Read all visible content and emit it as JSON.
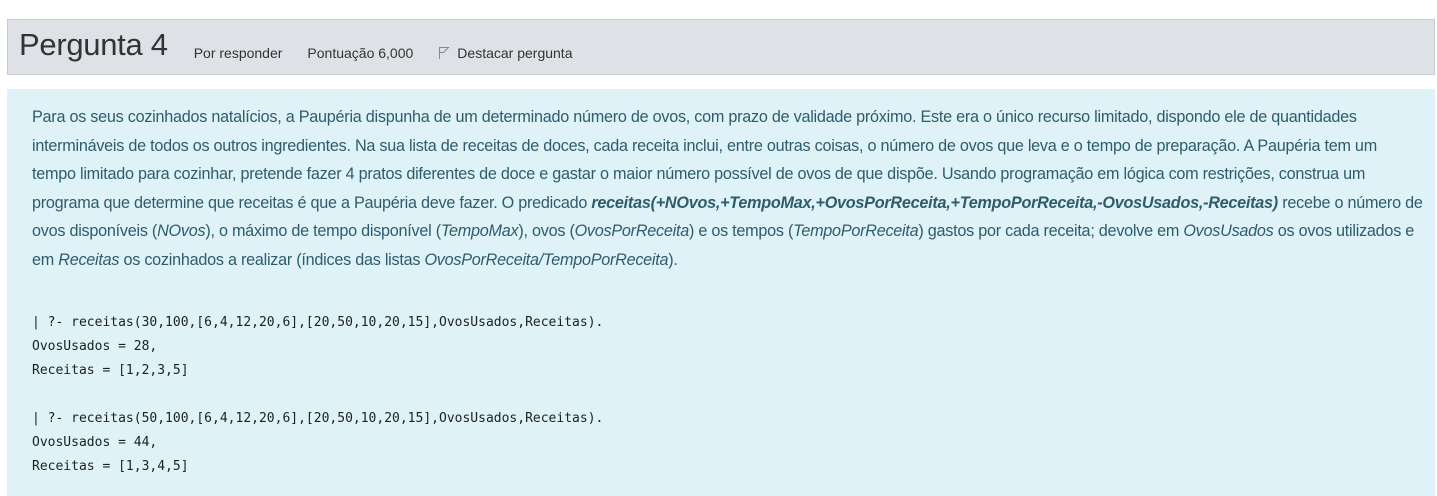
{
  "header": {
    "title_prefix": "Pergunta",
    "number": "4",
    "status": "Por responder",
    "score": "Pontuação 6,000",
    "flag_label": "Destacar pergunta"
  },
  "question": {
    "p1": "Para os seus cozinhados natalícios, a Paupéria dispunha de um determinado número de ovos, com prazo de validade próximo. Este era o único recurso limitado, dispondo ele de quantidades intermináveis de todos os outros ingredientes. Na sua lista de receitas de doces, cada receita inclui, entre outras coisas, o número de ovos que leva e o tempo de preparação. A Paupéria tem um tempo limitado para cozinhar, pretende fazer 4 pratos diferentes de doce e gastar o maior número possível de ovos de que dispõe. Usando programação em lógica com restrições, construa um programa que determine que receitas é que a Paupéria deve fazer. O predicado ",
    "predicate": "receitas(+NOvos,+TempoMax,+OvosPorReceita,+TempoPorReceita,-OvosUsados,-Receitas)",
    "t1": " recebe o número de ovos disponíveis (",
    "i1": "NOvos",
    "t2": "), o máximo de tempo disponível (",
    "i2": "TempoMax",
    "t3": "), ovos (",
    "i3": "OvosPorReceita",
    "t4": ") e os tempos (",
    "i4": "TempoPorReceita",
    "t5": ") gastos por cada receita; devolve em ",
    "i5": "OvosUsados",
    "t6": " os ovos utilizados e em ",
    "i6": "Receitas",
    "t7": " os cozinhados a realizar (índices das listas ",
    "i7": "OvosPorReceita/TempoPorReceita",
    "t8": ")."
  },
  "examples": [
    [
      "| ?- receitas(30,100,[6,4,12,20,6],[20,50,10,20,15],OvosUsados,Receitas).",
      "OvosUsados = 28,",
      "Receitas = [1,2,3,5]"
    ],
    [
      "| ?- receitas(50,100,[6,4,12,20,6],[20,50,10,20,15],OvosUsados,Receitas).",
      "OvosUsados = 44,",
      "Receitas = [1,3,4,5]"
    ]
  ]
}
